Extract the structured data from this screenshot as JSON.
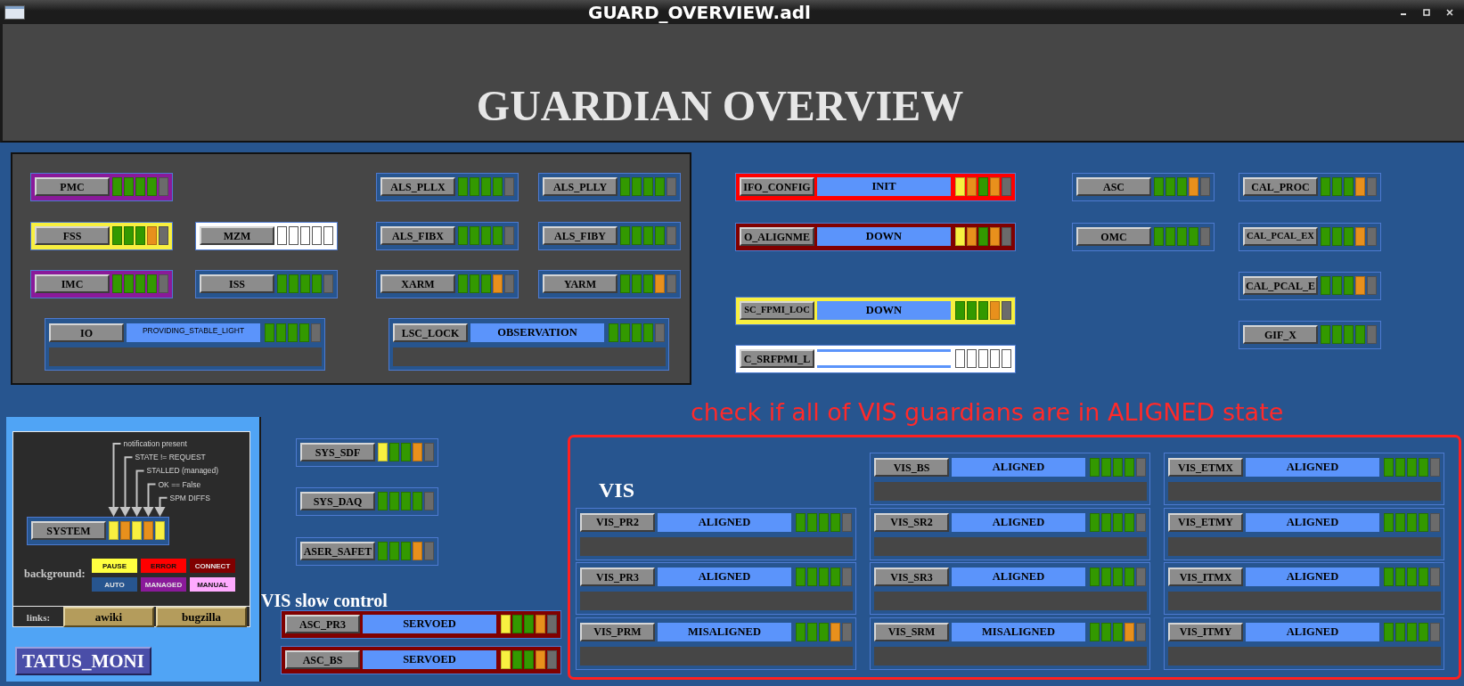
{
  "window": {
    "title": "GUARD_OVERVIEW.adl"
  },
  "header": {
    "title": "GUARDIAN OVERVIEW"
  },
  "main_panel": {
    "guardians": [
      {
        "kind": "compact",
        "name": "PMC",
        "color": "#8a1a9a",
        "indicators": [
          {
            "color": "#339900"
          },
          {
            "color": "#339900"
          },
          {
            "color": "#339900"
          },
          {
            "color": "#339900"
          },
          {
            "color": "#6b6b6b"
          }
        ]
      },
      {
        "kind": "compact",
        "name": "ALS_PLLX",
        "color": "#27558f",
        "indicators": [
          {
            "color": "#339900"
          },
          {
            "color": "#339900"
          },
          {
            "color": "#339900"
          },
          {
            "color": "#339900"
          },
          {
            "color": "#6b6b6b"
          }
        ]
      },
      {
        "kind": "compact",
        "name": "ALS_PLLY",
        "color": "#27558f",
        "indicators": [
          {
            "color": "#339900"
          },
          {
            "color": "#339900"
          },
          {
            "color": "#339900"
          },
          {
            "color": "#339900"
          },
          {
            "color": "#6b6b6b"
          }
        ]
      },
      {
        "kind": "compact",
        "name": "FSS",
        "color": "#f8f040",
        "indicators": [
          {
            "color": "#339900"
          },
          {
            "color": "#339900"
          },
          {
            "color": "#339900"
          },
          {
            "color": "#e8901c"
          },
          {
            "color": "#6b6b6b"
          }
        ]
      },
      {
        "kind": "compact",
        "name": "MZM",
        "color": "#ffffff",
        "indicators": [
          {
            "color": "#ffffff"
          },
          {
            "color": "#ffffff"
          },
          {
            "color": "#ffffff"
          },
          {
            "color": "#ffffff"
          },
          {
            "color": "#ffffff"
          }
        ]
      },
      {
        "kind": "compact",
        "name": "ALS_FIBX",
        "color": "#27558f",
        "indicators": [
          {
            "color": "#339900"
          },
          {
            "color": "#339900"
          },
          {
            "color": "#339900"
          },
          {
            "color": "#339900"
          },
          {
            "color": "#6b6b6b"
          }
        ]
      },
      {
        "kind": "compact",
        "name": "ALS_FIBY",
        "color": "#27558f",
        "indicators": [
          {
            "color": "#339900"
          },
          {
            "color": "#339900"
          },
          {
            "color": "#339900"
          },
          {
            "color": "#339900"
          },
          {
            "color": "#6b6b6b"
          }
        ]
      },
      {
        "kind": "compact",
        "name": "IMC",
        "color": "#8a1a9a",
        "indicators": [
          {
            "color": "#339900"
          },
          {
            "color": "#339900"
          },
          {
            "color": "#339900"
          },
          {
            "color": "#339900"
          },
          {
            "color": "#6b6b6b"
          }
        ]
      },
      {
        "kind": "compact",
        "name": "ISS",
        "color": "#27558f",
        "indicators": [
          {
            "color": "#339900"
          },
          {
            "color": "#339900"
          },
          {
            "color": "#339900"
          },
          {
            "color": "#339900"
          },
          {
            "color": "#6b6b6b"
          }
        ]
      },
      {
        "kind": "compact",
        "name": "XARM",
        "color": "#27558f",
        "indicators": [
          {
            "color": "#339900"
          },
          {
            "color": "#339900"
          },
          {
            "color": "#339900"
          },
          {
            "color": "#e8901c"
          },
          {
            "color": "#6b6b6b"
          }
        ]
      },
      {
        "kind": "compact",
        "name": "YARM",
        "color": "#27558f",
        "indicators": [
          {
            "color": "#339900"
          },
          {
            "color": "#339900"
          },
          {
            "color": "#339900"
          },
          {
            "color": "#e8901c"
          },
          {
            "color": "#6b6b6b"
          }
        ]
      },
      {
        "kind": "state_message",
        "name": "IO",
        "state": "PROVIDING_STABLE_LIGHT",
        "color": "#27558f",
        "indicators": [
          {
            "color": "#339900"
          },
          {
            "color": "#339900"
          },
          {
            "color": "#339900"
          },
          {
            "color": "#339900"
          },
          {
            "color": "#6b6b6b"
          }
        ]
      },
      {
        "kind": "state_message",
        "name": "LSC_LOCK",
        "state": "OBSERVATION",
        "color": "#27558f",
        "indicators": [
          {
            "color": "#339900"
          },
          {
            "color": "#339900"
          },
          {
            "color": "#339900"
          },
          {
            "color": "#339900"
          },
          {
            "color": "#6b6b6b"
          }
        ]
      }
    ]
  },
  "top_right": {
    "guardians": [
      {
        "kind": "state",
        "name": "IFO_CONFIG",
        "state": "INIT",
        "color": "#ff0000",
        "indicators": [
          {
            "color": "#f8f040"
          },
          {
            "color": "#e8901c"
          },
          {
            "color": "#339900"
          },
          {
            "color": "#e8901c"
          },
          {
            "color": "#6b6b6b"
          }
        ]
      },
      {
        "kind": "compact",
        "name": "ASC",
        "indicators": [
          {
            "color": "#339900"
          },
          {
            "color": "#339900"
          },
          {
            "color": "#339900"
          },
          {
            "color": "#e8901c"
          },
          {
            "color": "#6b6b6b"
          }
        ]
      },
      {
        "kind": "compact",
        "name": "CAL_PROC",
        "indicators": [
          {
            "color": "#339900"
          },
          {
            "color": "#339900"
          },
          {
            "color": "#339900"
          },
          {
            "color": "#e8901c"
          },
          {
            "color": "#6b6b6b"
          }
        ]
      },
      {
        "kind": "state",
        "name": "O_ALIGNME",
        "state": "DOWN",
        "color": "#800000",
        "indicators": [
          {
            "color": "#f8f040"
          },
          {
            "color": "#e8901c"
          },
          {
            "color": "#339900"
          },
          {
            "color": "#e8901c"
          },
          {
            "color": "#6b6b6b"
          }
        ]
      },
      {
        "kind": "compact",
        "name": "OMC",
        "indicators": [
          {
            "color": "#339900"
          },
          {
            "color": "#339900"
          },
          {
            "color": "#339900"
          },
          {
            "color": "#339900"
          },
          {
            "color": "#6b6b6b"
          }
        ]
      },
      {
        "kind": "compact",
        "name": "CAL_PCAL_EX",
        "indicators": [
          {
            "color": "#339900"
          },
          {
            "color": "#339900"
          },
          {
            "color": "#339900"
          },
          {
            "color": "#e8901c"
          },
          {
            "color": "#6b6b6b"
          }
        ]
      },
      {
        "kind": "compact",
        "name": "CAL_PCAL_E",
        "indicators": [
          {
            "color": "#339900"
          },
          {
            "color": "#339900"
          },
          {
            "color": "#339900"
          },
          {
            "color": "#e8901c"
          },
          {
            "color": "#6b6b6b"
          }
        ]
      },
      {
        "kind": "state",
        "name": "SC_FPMI_LOC",
        "state": "DOWN",
        "color": "#f8f040",
        "indicators": [
          {
            "color": "#339900"
          },
          {
            "color": "#339900"
          },
          {
            "color": "#339900"
          },
          {
            "color": "#e8901c"
          },
          {
            "color": "#6b6b6b"
          }
        ]
      },
      {
        "kind": "compact",
        "name": "GIF_X",
        "indicators": [
          {
            "color": "#339900"
          },
          {
            "color": "#339900"
          },
          {
            "color": "#339900"
          },
          {
            "color": "#339900"
          },
          {
            "color": "#6b6b6b"
          }
        ]
      },
      {
        "kind": "state",
        "name": "C_SRFPMI_L",
        "color": "#ffffff",
        "indicators": [
          {
            "color": "#ffffff"
          },
          {
            "color": "#ffffff"
          },
          {
            "color": "#ffffff"
          },
          {
            "color": "#ffffff"
          },
          {
            "color": "#ffffff"
          }
        ]
      }
    ]
  },
  "annotation": {
    "text": "check if all of VIS guardians are in ALIGNED state"
  },
  "status_monitor": {
    "legend_labels": [
      "notification present",
      "STATE != REQUEST",
      "STALLED (managed)",
      "OK == False",
      "SPM DIFFS"
    ],
    "system": {
      "kind": "compact",
      "name": "SYSTEM",
      "color": "#27558f",
      "indicators": [
        {
          "color": "#f8f040"
        },
        {
          "color": "#e8901c"
        },
        {
          "color": "#f8f040"
        },
        {
          "color": "#e8901c"
        },
        {
          "color": "#f8f040"
        }
      ]
    },
    "background_label": "background:",
    "modes": [
      {
        "label": "PAUSE",
        "color": "#ffff40"
      },
      {
        "label": "ERROR",
        "color": "#ff0000"
      },
      {
        "label": "CONNECT",
        "color": "#800000"
      },
      {
        "label": "AUTO",
        "color": "#27558f"
      },
      {
        "label": "MANAGED",
        "color": "#8a1a9a"
      },
      {
        "label": "MANUAL",
        "color": "#ffaaff"
      }
    ],
    "links_label": "links:",
    "links": [
      {
        "label": "awiki"
      },
      {
        "label": "bugzilla"
      }
    ],
    "button": {
      "label": "TATUS_MONI"
    }
  },
  "system_guardians": [
    {
      "kind": "compact",
      "name": "SYS_SDF",
      "indicators": [
        {
          "color": "#f8f040"
        },
        {
          "color": "#339900"
        },
        {
          "color": "#339900"
        },
        {
          "color": "#e8901c"
        },
        {
          "color": "#6b6b6b"
        }
      ]
    },
    {
      "kind": "compact",
      "name": "SYS_DAQ",
      "indicators": [
        {
          "color": "#339900"
        },
        {
          "color": "#339900"
        },
        {
          "color": "#339900"
        },
        {
          "color": "#339900"
        },
        {
          "color": "#6b6b6b"
        }
      ]
    },
    {
      "kind": "compact",
      "name": "ASER_SAFET",
      "indicators": [
        {
          "color": "#339900"
        },
        {
          "color": "#339900"
        },
        {
          "color": "#339900"
        },
        {
          "color": "#e8901c"
        },
        {
          "color": "#6b6b6b"
        }
      ]
    }
  ],
  "vis_slow_control": {
    "title": "VIS slow control",
    "guardians": [
      {
        "kind": "state",
        "name": "ASC_PR3",
        "state": "SERVOED",
        "color": "#800000",
        "indicators": [
          {
            "color": "#f8f040"
          },
          {
            "color": "#339900"
          },
          {
            "color": "#339900"
          },
          {
            "color": "#e8901c"
          },
          {
            "color": "#6b6b6b"
          }
        ]
      },
      {
        "kind": "state",
        "name": "ASC_BS",
        "state": "SERVOED",
        "color": "#800000",
        "indicators": [
          {
            "color": "#f8f040"
          },
          {
            "color": "#339900"
          },
          {
            "color": "#339900"
          },
          {
            "color": "#e8901c"
          },
          {
            "color": "#6b6b6b"
          }
        ]
      }
    ]
  },
  "vis": {
    "title": "VIS",
    "guardians": [
      {
        "kind": "state_message",
        "name": "VIS_BS",
        "state": "ALIGNED",
        "indicators": [
          {
            "color": "#339900"
          },
          {
            "color": "#339900"
          },
          {
            "color": "#339900"
          },
          {
            "color": "#339900"
          },
          {
            "color": "#6b6b6b"
          }
        ]
      },
      {
        "kind": "state_message",
        "name": "VIS_ETMX",
        "state": "ALIGNED",
        "indicators": [
          {
            "color": "#339900"
          },
          {
            "color": "#339900"
          },
          {
            "color": "#339900"
          },
          {
            "color": "#339900"
          },
          {
            "color": "#6b6b6b"
          }
        ]
      },
      {
        "kind": "state_message",
        "name": "VIS_PR2",
        "state": "ALIGNED",
        "indicators": [
          {
            "color": "#339900"
          },
          {
            "color": "#339900"
          },
          {
            "color": "#339900"
          },
          {
            "color": "#339900"
          },
          {
            "color": "#6b6b6b"
          }
        ]
      },
      {
        "kind": "state_message",
        "name": "VIS_SR2",
        "state": "ALIGNED",
        "indicators": [
          {
            "color": "#339900"
          },
          {
            "color": "#339900"
          },
          {
            "color": "#339900"
          },
          {
            "color": "#339900"
          },
          {
            "color": "#6b6b6b"
          }
        ]
      },
      {
        "kind": "state_message",
        "name": "VIS_ETMY",
        "state": "ALIGNED",
        "indicators": [
          {
            "color": "#339900"
          },
          {
            "color": "#339900"
          },
          {
            "color": "#339900"
          },
          {
            "color": "#339900"
          },
          {
            "color": "#6b6b6b"
          }
        ]
      },
      {
        "kind": "state_message",
        "name": "VIS_PR3",
        "state": "ALIGNED",
        "indicators": [
          {
            "color": "#339900"
          },
          {
            "color": "#339900"
          },
          {
            "color": "#339900"
          },
          {
            "color": "#339900"
          },
          {
            "color": "#6b6b6b"
          }
        ]
      },
      {
        "kind": "state_message",
        "name": "VIS_SR3",
        "state": "ALIGNED",
        "indicators": [
          {
            "color": "#339900"
          },
          {
            "color": "#339900"
          },
          {
            "color": "#339900"
          },
          {
            "color": "#339900"
          },
          {
            "color": "#6b6b6b"
          }
        ]
      },
      {
        "kind": "state_message",
        "name": "VIS_ITMX",
        "state": "ALIGNED",
        "indicators": [
          {
            "color": "#339900"
          },
          {
            "color": "#339900"
          },
          {
            "color": "#339900"
          },
          {
            "color": "#339900"
          },
          {
            "color": "#6b6b6b"
          }
        ]
      },
      {
        "kind": "state_message",
        "name": "VIS_PRM",
        "state": "MISALIGNED",
        "indicators": [
          {
            "color": "#339900"
          },
          {
            "color": "#339900"
          },
          {
            "color": "#339900"
          },
          {
            "color": "#e8901c"
          },
          {
            "color": "#6b6b6b"
          }
        ]
      },
      {
        "kind": "state_message",
        "name": "VIS_SRM",
        "state": "MISALIGNED",
        "indicators": [
          {
            "color": "#339900"
          },
          {
            "color": "#339900"
          },
          {
            "color": "#339900"
          },
          {
            "color": "#e8901c"
          },
          {
            "color": "#6b6b6b"
          }
        ]
      },
      {
        "kind": "state_message",
        "name": "VIS_ITMY",
        "state": "ALIGNED",
        "indicators": [
          {
            "color": "#339900"
          },
          {
            "color": "#339900"
          },
          {
            "color": "#339900"
          },
          {
            "color": "#339900"
          },
          {
            "color": "#6b6b6b"
          }
        ]
      }
    ]
  }
}
